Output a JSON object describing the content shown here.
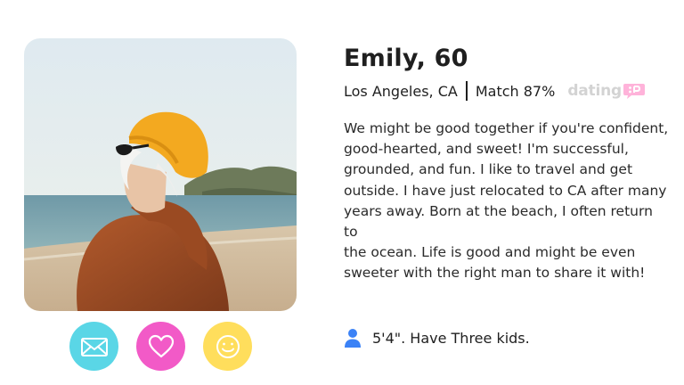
{
  "profile": {
    "name_age": "Emily, 60",
    "location": "Los Angeles, CA",
    "match": "Match 87%",
    "brand": {
      "text": "dating",
      "badge_icon": "speech-bubble-logo-icon",
      "color": "#d3d3d3",
      "badge_color": "#ffb3da"
    },
    "bio_lines": [
      "We might be good together if you're confident,",
      "good-hearted, and sweet! I'm successful,",
      "grounded, and fun. I like to travel and get",
      "outside. I have just relocated to CA after many",
      "years away. Born at the beach, I often return to",
      "the ocean. Life is good and might be even",
      "sweeter with the right man to share it with!"
    ],
    "details": "5'4\". Have Three kids.",
    "details_icon": "person-icon"
  },
  "actions": [
    {
      "name": "message-button",
      "icon": "envelope-icon",
      "color": "#5ad6e6"
    },
    {
      "name": "like-button",
      "icon": "heart-icon",
      "color": "#f25ac7"
    },
    {
      "name": "smile-button",
      "icon": "smiley-icon",
      "color": "#ffde5c"
    }
  ],
  "colors": {
    "accent_blue": "#3b82f6"
  }
}
